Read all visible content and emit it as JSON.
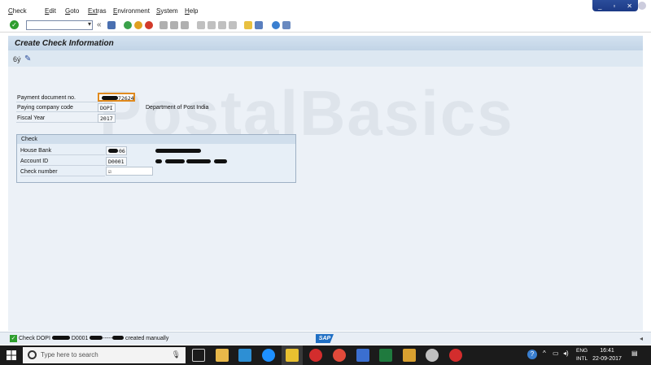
{
  "menu": {
    "items": [
      {
        "label": "Check",
        "u": "C",
        "rest": "heck"
      },
      {
        "label": "Edit",
        "u": "E",
        "rest": "dit"
      },
      {
        "label": "Goto",
        "u": "G",
        "rest": "oto"
      },
      {
        "label": "Extras",
        "u": "Ext",
        "rest": "ras"
      },
      {
        "label": "Environment",
        "u": "E",
        "rest": "nvironment"
      },
      {
        "label": "System",
        "u": "S",
        "rest": "ystem"
      },
      {
        "label": "Help",
        "u": "H",
        "rest": "elp"
      }
    ]
  },
  "window": {
    "minimize": "_",
    "restore": "▫",
    "close": "✕"
  },
  "toolbar": {
    "command_value": "",
    "back_arrows": "«"
  },
  "screen": {
    "title": "Create Check Information"
  },
  "watermark": "PostalBasics",
  "form": {
    "payment_doc_label": "Payment document no.",
    "payment_doc_value": "72624",
    "company_code_label": "Paying company code",
    "company_code_value": "DOPI",
    "company_code_desc": "Department of Post India",
    "fiscal_year_label": "Fiscal Year",
    "fiscal_year_value": "2017"
  },
  "check_group": {
    "title": "Check",
    "house_bank_label": "House Bank",
    "house_bank_value": "06",
    "account_id_label": "Account ID",
    "account_id_value": "D0001",
    "check_number_label": "Check number",
    "check_number_value": "☑"
  },
  "status": {
    "part1": "Check DOPI",
    "part2": "D0001",
    "part3": "-----",
    "part4": "created manually",
    "sap_logo": "SAP"
  },
  "taskbar": {
    "search_placeholder": "Type here to search",
    "lang_top": "ENG",
    "lang_bottom": "INTL",
    "time": "16:41",
    "date": "22-09-2017"
  },
  "colors": {
    "accent": "#2b4d9b",
    "title_bg": "#c2d4e6",
    "content_bg": "#ecf1f7",
    "focus": "#e08a1e"
  }
}
